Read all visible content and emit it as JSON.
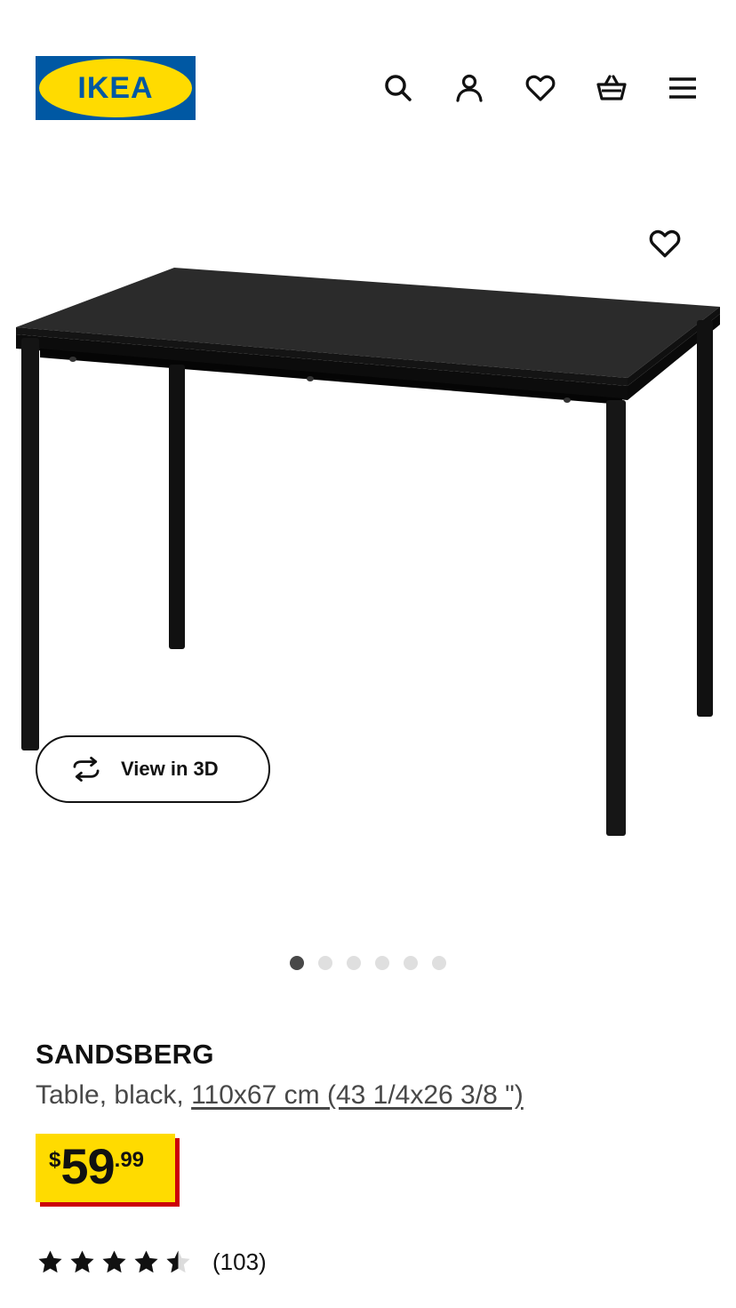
{
  "header": {
    "logo_text": "IKEA",
    "logo_colors": {
      "background": "#0058a3",
      "oval": "#ffdb00",
      "text": "#0058a3"
    },
    "icons": [
      "search-icon",
      "account-icon",
      "heart-icon",
      "basket-icon",
      "menu-icon"
    ]
  },
  "product": {
    "name": "SANDSBERG",
    "description_prefix": "Table, black, ",
    "dimensions": "110x67 cm (43 1/4x26 3/8 \")",
    "price": {
      "currency": "$",
      "integer": "59",
      "decimal": ".99"
    },
    "rating": {
      "value": 4.5,
      "max": 5,
      "count_text": "(103)"
    }
  },
  "gallery": {
    "view_3d_label": "View in 3D",
    "image_count": 6,
    "active_index": 0
  },
  "colors": {
    "price_box": "#ffdb00",
    "price_shadow": "#cc0008",
    "text": "#111111",
    "secondary_text": "#484848"
  }
}
